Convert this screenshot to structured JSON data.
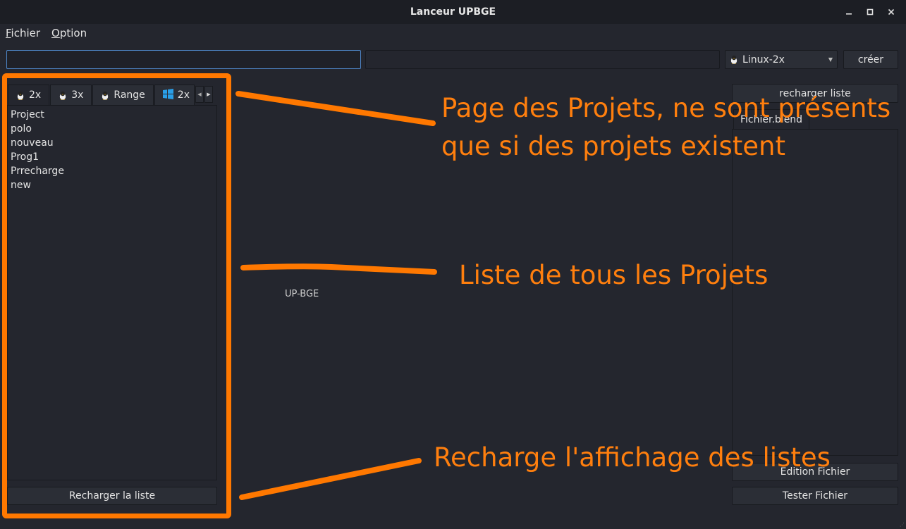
{
  "window": {
    "title": "Lanceur UPBGE",
    "controls": [
      "minimize-icon",
      "maximize-icon",
      "close-icon"
    ]
  },
  "menu": {
    "items": [
      {
        "label_first": "F",
        "label_rest": "ichier"
      },
      {
        "label_first": "O",
        "label_rest": "ption"
      }
    ]
  },
  "toolbar": {
    "name_value": "",
    "version_selected": "Linux-2x",
    "create_label": "créer"
  },
  "tabs": [
    {
      "label": "2x",
      "icon": "linux-icon",
      "active": true
    },
    {
      "label": "3x",
      "icon": "linux-icon",
      "active": false
    },
    {
      "label": "Range",
      "icon": "linux-icon",
      "active": false
    },
    {
      "label": "2x",
      "icon": "windows-icon",
      "active": false
    }
  ],
  "projects": [
    "Project",
    "polo",
    "nouveau",
    "Prog1",
    "Prrecharge",
    "new"
  ],
  "left_panel": {
    "reload_label": "Recharger la liste"
  },
  "center": {
    "label": "UP-BGE"
  },
  "right_panel": {
    "refresh_label": "recharger liste",
    "file_tab_label": "Fichier.blend",
    "edit_label": "Edition Fichier",
    "test_label": "Tester Fichier"
  },
  "annotations": {
    "color": "#ff7800",
    "text1_line1": "Page des Projets, ne sont présents",
    "text1_line2": "que si des projets existent",
    "text2": "Liste de tous les Projets",
    "text3": "Recharge l'affichage des listes"
  }
}
